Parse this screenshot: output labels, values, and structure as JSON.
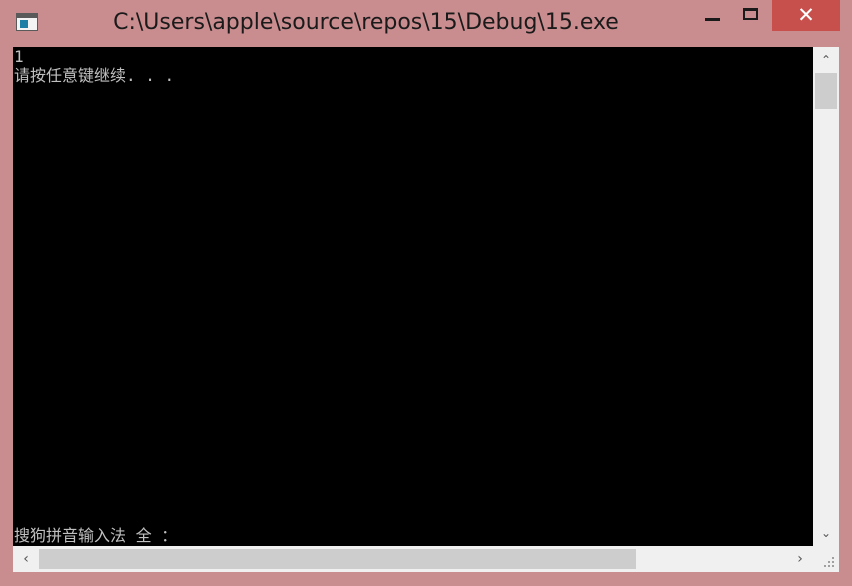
{
  "window": {
    "title": "C:\\Users\\apple\\source\\repos\\15\\Debug\\15.exe",
    "icon": "console-app-icon",
    "controls": {
      "minimize_icon": "minimize-icon",
      "maximize_icon": "maximize-icon",
      "close_glyph": "✕"
    }
  },
  "console": {
    "lines": [
      "1",
      "请按任意键继续. . ."
    ],
    "ime_status": "搜狗拼音输入法 全 ："
  },
  "scrollbars": {
    "up_arrow": "⌃",
    "down_arrow": "⌄",
    "left_arrow": "‹",
    "right_arrow": "›"
  },
  "colors": {
    "frame": "#c98c8f",
    "console_bg": "#000000",
    "console_text": "#c0c0c0",
    "close_button": "#c7504d"
  }
}
